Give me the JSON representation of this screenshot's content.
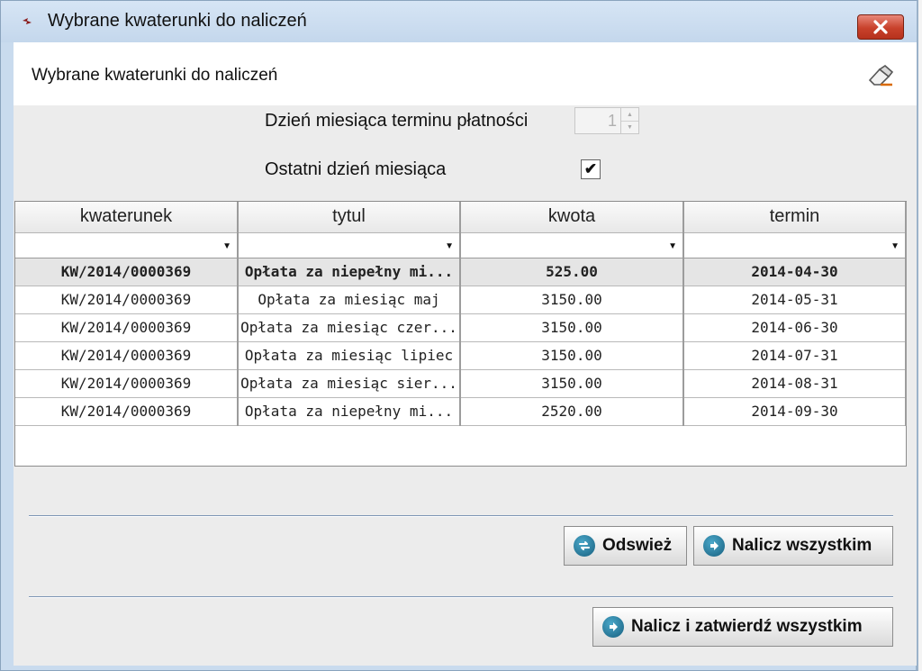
{
  "window": {
    "title": "Wybrane kwaterunki do naliczeń"
  },
  "header": {
    "title": "Wybrane kwaterunki do naliczeń"
  },
  "form": {
    "payment_day_label": "Dzień miesiąca terminu płatności",
    "payment_day_value": "1",
    "last_day_label": "Ostatni dzień miesiąca",
    "last_day_checked": "✔"
  },
  "table": {
    "columns": [
      "kwaterunek",
      "tytul",
      "kwota",
      "termin"
    ],
    "rows": [
      [
        "KW/2014/0000369",
        "Opłata za niepełny mi...",
        "525.00",
        "2014-04-30"
      ],
      [
        "KW/2014/0000369",
        "Opłata za miesiąc maj",
        "3150.00",
        "2014-05-31"
      ],
      [
        "KW/2014/0000369",
        "Opłata za miesiąc czer...",
        "3150.00",
        "2014-06-30"
      ],
      [
        "KW/2014/0000369",
        "Opłata za miesiąc lipiec",
        "3150.00",
        "2014-07-31"
      ],
      [
        "KW/2014/0000369",
        "Opłata za miesiąc sier...",
        "3150.00",
        "2014-08-31"
      ],
      [
        "KW/2014/0000369",
        "Opłata za niepełny mi...",
        "2520.00",
        "2014-09-30"
      ]
    ]
  },
  "buttons": {
    "refresh": "Odswież",
    "charge_all": "Nalicz wszystkim",
    "charge_confirm_all": "Nalicz i zatwierdź wszystkim"
  },
  "icons": {
    "window": "window-icon",
    "close": "close-icon",
    "eraser": "eraser-icon",
    "refresh": "refresh-icon",
    "arrow": "arrow-right-circle-icon"
  },
  "colors": {
    "title_bar": "#c9dbee",
    "close_button": "#c8412b",
    "button_icon": "#1f6f92"
  }
}
